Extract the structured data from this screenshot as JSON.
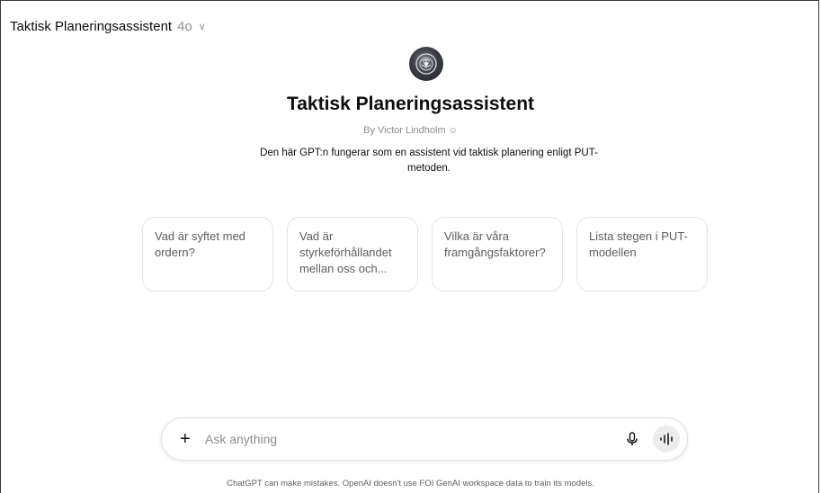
{
  "header": {
    "title": "Taktisk Planeringsassistent",
    "model": "4o",
    "chevron_icon": "chevron-down-icon"
  },
  "gpt": {
    "name": "Taktisk Planeringsassistent",
    "author": "By Victor Lindholm",
    "author_icon": "person-icon",
    "description": "Den här GPT:n fungerar som en assistent vid taktisk planering enligt PUT-metoden."
  },
  "starters": [
    {
      "label": "Vad är syftet med ordern?"
    },
    {
      "label": "Vad är styrkeförhållandet mellan oss och..."
    },
    {
      "label": "Vilka är våra framgångsfaktorer?"
    },
    {
      "label": "Lista stegen i PUT-modellen"
    }
  ],
  "composer": {
    "placeholder": "Ask anything",
    "plus_icon": "plus-icon",
    "mic_icon": "microphone-icon",
    "voice_icon": "voice-mode-icon"
  },
  "footer": {
    "disclaimer": "ChatGPT can make mistakes. OpenAI doesn't use FOI GenAI workspace data to train its models."
  },
  "colors": {
    "text": "#0d0d0d",
    "muted": "#8e8e8e",
    "card_border": "#e3e3e3",
    "voice_bg": "#ececec"
  }
}
